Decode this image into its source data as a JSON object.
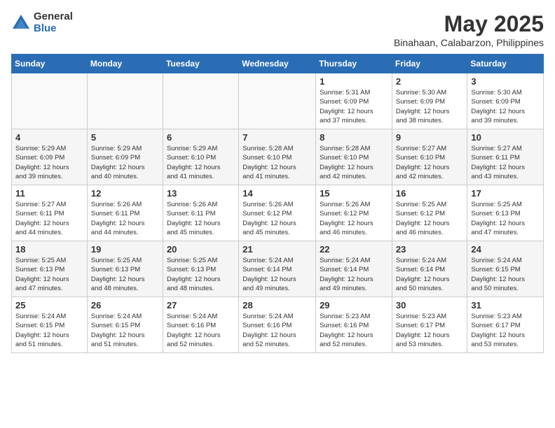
{
  "header": {
    "logo_general": "General",
    "logo_blue": "Blue",
    "month_year": "May 2025",
    "location": "Binahaan, Calabarzon, Philippines"
  },
  "days_of_week": [
    "Sunday",
    "Monday",
    "Tuesday",
    "Wednesday",
    "Thursday",
    "Friday",
    "Saturday"
  ],
  "weeks": [
    [
      {
        "day": "",
        "info": ""
      },
      {
        "day": "",
        "info": ""
      },
      {
        "day": "",
        "info": ""
      },
      {
        "day": "",
        "info": ""
      },
      {
        "day": "1",
        "info": "Sunrise: 5:31 AM\nSunset: 6:09 PM\nDaylight: 12 hours\nand 37 minutes."
      },
      {
        "day": "2",
        "info": "Sunrise: 5:30 AM\nSunset: 6:09 PM\nDaylight: 12 hours\nand 38 minutes."
      },
      {
        "day": "3",
        "info": "Sunrise: 5:30 AM\nSunset: 6:09 PM\nDaylight: 12 hours\nand 39 minutes."
      }
    ],
    [
      {
        "day": "4",
        "info": "Sunrise: 5:29 AM\nSunset: 6:09 PM\nDaylight: 12 hours\nand 39 minutes."
      },
      {
        "day": "5",
        "info": "Sunrise: 5:29 AM\nSunset: 6:09 PM\nDaylight: 12 hours\nand 40 minutes."
      },
      {
        "day": "6",
        "info": "Sunrise: 5:29 AM\nSunset: 6:10 PM\nDaylight: 12 hours\nand 41 minutes."
      },
      {
        "day": "7",
        "info": "Sunrise: 5:28 AM\nSunset: 6:10 PM\nDaylight: 12 hours\nand 41 minutes."
      },
      {
        "day": "8",
        "info": "Sunrise: 5:28 AM\nSunset: 6:10 PM\nDaylight: 12 hours\nand 42 minutes."
      },
      {
        "day": "9",
        "info": "Sunrise: 5:27 AM\nSunset: 6:10 PM\nDaylight: 12 hours\nand 42 minutes."
      },
      {
        "day": "10",
        "info": "Sunrise: 5:27 AM\nSunset: 6:11 PM\nDaylight: 12 hours\nand 43 minutes."
      }
    ],
    [
      {
        "day": "11",
        "info": "Sunrise: 5:27 AM\nSunset: 6:11 PM\nDaylight: 12 hours\nand 44 minutes."
      },
      {
        "day": "12",
        "info": "Sunrise: 5:26 AM\nSunset: 6:11 PM\nDaylight: 12 hours\nand 44 minutes."
      },
      {
        "day": "13",
        "info": "Sunrise: 5:26 AM\nSunset: 6:11 PM\nDaylight: 12 hours\nand 45 minutes."
      },
      {
        "day": "14",
        "info": "Sunrise: 5:26 AM\nSunset: 6:12 PM\nDaylight: 12 hours\nand 45 minutes."
      },
      {
        "day": "15",
        "info": "Sunrise: 5:26 AM\nSunset: 6:12 PM\nDaylight: 12 hours\nand 46 minutes."
      },
      {
        "day": "16",
        "info": "Sunrise: 5:25 AM\nSunset: 6:12 PM\nDaylight: 12 hours\nand 46 minutes."
      },
      {
        "day": "17",
        "info": "Sunrise: 5:25 AM\nSunset: 6:13 PM\nDaylight: 12 hours\nand 47 minutes."
      }
    ],
    [
      {
        "day": "18",
        "info": "Sunrise: 5:25 AM\nSunset: 6:13 PM\nDaylight: 12 hours\nand 47 minutes."
      },
      {
        "day": "19",
        "info": "Sunrise: 5:25 AM\nSunset: 6:13 PM\nDaylight: 12 hours\nand 48 minutes."
      },
      {
        "day": "20",
        "info": "Sunrise: 5:25 AM\nSunset: 6:13 PM\nDaylight: 12 hours\nand 48 minutes."
      },
      {
        "day": "21",
        "info": "Sunrise: 5:24 AM\nSunset: 6:14 PM\nDaylight: 12 hours\nand 49 minutes."
      },
      {
        "day": "22",
        "info": "Sunrise: 5:24 AM\nSunset: 6:14 PM\nDaylight: 12 hours\nand 49 minutes."
      },
      {
        "day": "23",
        "info": "Sunrise: 5:24 AM\nSunset: 6:14 PM\nDaylight: 12 hours\nand 50 minutes."
      },
      {
        "day": "24",
        "info": "Sunrise: 5:24 AM\nSunset: 6:15 PM\nDaylight: 12 hours\nand 50 minutes."
      }
    ],
    [
      {
        "day": "25",
        "info": "Sunrise: 5:24 AM\nSunset: 6:15 PM\nDaylight: 12 hours\nand 51 minutes."
      },
      {
        "day": "26",
        "info": "Sunrise: 5:24 AM\nSunset: 6:15 PM\nDaylight: 12 hours\nand 51 minutes."
      },
      {
        "day": "27",
        "info": "Sunrise: 5:24 AM\nSunset: 6:16 PM\nDaylight: 12 hours\nand 52 minutes."
      },
      {
        "day": "28",
        "info": "Sunrise: 5:24 AM\nSunset: 6:16 PM\nDaylight: 12 hours\nand 52 minutes."
      },
      {
        "day": "29",
        "info": "Sunrise: 5:23 AM\nSunset: 6:16 PM\nDaylight: 12 hours\nand 52 minutes."
      },
      {
        "day": "30",
        "info": "Sunrise: 5:23 AM\nSunset: 6:17 PM\nDaylight: 12 hours\nand 53 minutes."
      },
      {
        "day": "31",
        "info": "Sunrise: 5:23 AM\nSunset: 6:17 PM\nDaylight: 12 hours\nand 53 minutes."
      }
    ]
  ]
}
